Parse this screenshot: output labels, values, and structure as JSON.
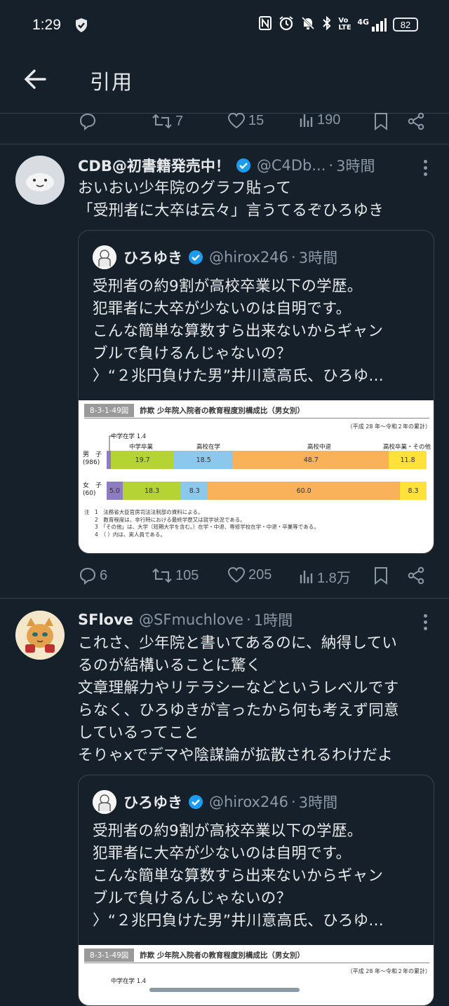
{
  "status": {
    "time": "1:29",
    "battery": "82",
    "network": "4G",
    "volte": "Vo LTE"
  },
  "header": {
    "title": "引用"
  },
  "top_actions": {
    "retweets": "7",
    "likes": "15",
    "views": "190"
  },
  "tweets": [
    {
      "name": "CDB@初書籍発売中！",
      "handle": "@C4Db...",
      "time": "3時間",
      "text": [
        "おいおい少年院のグラフ貼って",
        "「受刑者に大卒は云々」言うてるぞひろゆき"
      ],
      "quote": {
        "name": "ひろゆき",
        "handle": "@hirox246",
        "time": "3時間",
        "text": [
          "受刑者の約9割が高校卒業以下の学歴。",
          "犯罪者に大卒が少ないのは自明です。",
          "こんな簡単な算数すら出来ないからギャン",
          "ブルで負けるんじゃないの？",
          "〉“２兆円負けた男”井川意高氏、ひろゆ..."
        ]
      },
      "actions": {
        "replies": "6",
        "retweets": "105",
        "likes": "205",
        "views": "1.8万"
      }
    },
    {
      "name": "SFlove",
      "handle": "@SFmuchlove",
      "time": "1時間",
      "text": [
        "これさ、少年院と書いてあるのに、納得してい",
        "るのが結構いることに驚く",
        "文章理解力やリテラシーなどというレベルです",
        "らなく、ひろゆきが言ったから何も考えず同意",
        "しているってこと",
        "そりゃxでデマや陰謀論が拡散されるわけだよ"
      ],
      "quote": {
        "name": "ひろゆき",
        "handle": "@hirox246",
        "time": "3時間",
        "text": [
          "受刑者の約9割が高校卒業以下の学歴。",
          "犯罪者に大卒が少ないのは自明です。",
          "こんな簡単な算数すら出来ないからギャン",
          "ブルで負けるんじゃないの？",
          "〉“２兆円負けた男”井川意高氏、ひろゆ..."
        ]
      }
    }
  ],
  "figure": {
    "number": "8-3-1-49図",
    "title": "詐欺 少年院入院者の教育程度別構成比（男女別）",
    "range": "（平成 28 年～令和２年の累計）",
    "categories": [
      "中学在学 1.4",
      "中学卒業",
      "高校在学",
      "高校中退",
      "高校卒業・その他"
    ],
    "rows": [
      {
        "label": "男　子",
        "count": "(986)"
      },
      {
        "label": "女　子",
        "count": "(60)"
      }
    ],
    "notes": [
      "注　1　法務省大臣官房司法法制部の資料による。",
      "　　2　教育程度は、非行時における最終学歴又は就学状況である。",
      "　　3　「その他」は、大学（短期大学を含む。）在学・中退、専修学校在学・中退・卒業等である。",
      "　　4　（ ）内は、実人員である。"
    ],
    "series_colors": [
      "#8e7cc3",
      "#b5d333",
      "#8cc7ec",
      "#f9b25a",
      "#ffe13a"
    ]
  },
  "chart_data": {
    "type": "bar",
    "title": "詐欺 少年院入院者の教育程度別構成比（男女別）",
    "categories": [
      "男子 (986)",
      "女子 (60)"
    ],
    "series": [
      {
        "name": "中学在学",
        "values": [
          1.4,
          5.0
        ]
      },
      {
        "name": "中学卒業",
        "values": [
          19.7,
          18.3
        ]
      },
      {
        "name": "高校在学",
        "values": [
          18.5,
          8.3
        ]
      },
      {
        "name": "高校中退",
        "values": [
          48.7,
          60.0
        ]
      },
      {
        "name": "高校卒業・その他",
        "values": [
          11.8,
          8.3
        ]
      }
    ],
    "stacked": true,
    "orientation": "horizontal",
    "xlim": [
      0,
      100
    ]
  }
}
